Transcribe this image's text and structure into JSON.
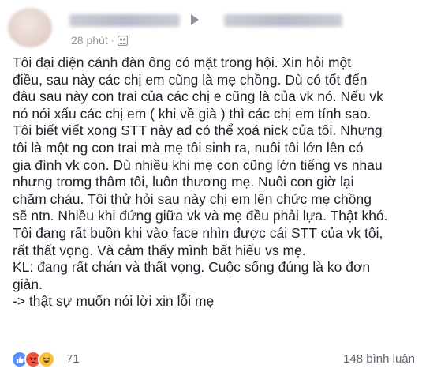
{
  "header": {
    "timestamp": "28 phút",
    "separator": "·",
    "audience_icon": "group-audience-icon"
  },
  "post": {
    "lines": [
      "Tôi đại diện cánh đàn ông có mặt trong hội. Xin hỏi một",
      "điều, sau này các chị em cũng là mẹ chồng. Dù có tốt đến",
      "đâu sau này con trai của các chị e cũng là của vk nó. Nếu vk",
      "nó nói xấu các chị em ( khi về già ) thì các chị em tính sao.",
      "Tôi biết viết xong STT này ad có thể xoá nick của tôi. Nhưng",
      "tôi là một ng con trai mà mẹ tôi sinh ra, nuôi tôi lớn lên có",
      "gia đình vk con. Dù nhiều khi mẹ con cũng lớn tiếng vs nhau",
      "nhưng tromg thâm tôi, luôn thương mẹ. Nuôi con giờ lại",
      "chăm cháu. Tôi thử hỏi sau này chị em lên chức mẹ chồng",
      "sẽ ntn. Nhiều khi đứng giữa vk và mẹ đều phải lựa. Thật khó.",
      "Tôi đang rất buồn khi vào face nhìn được cái STT của vk tôi,",
      "rất thất vọng. Và cảm thấy mình bất hiếu vs mẹ.",
      "KL: đang rất chán và thất vọng. Cuộc sống đúng là ko đơn",
      "giản.",
      "-> thật sự muốn nói lời xin lỗi mẹ"
    ]
  },
  "footer": {
    "reaction_count": "71",
    "comments_label": "148 bình luận",
    "reaction_icons": [
      "like-icon",
      "angry-icon",
      "haha-icon"
    ]
  },
  "colors": {
    "text": "#1d2129",
    "meta": "#90949c",
    "like": "#5890ff",
    "angry": "#f0533b",
    "haha": "#f7c33c"
  }
}
